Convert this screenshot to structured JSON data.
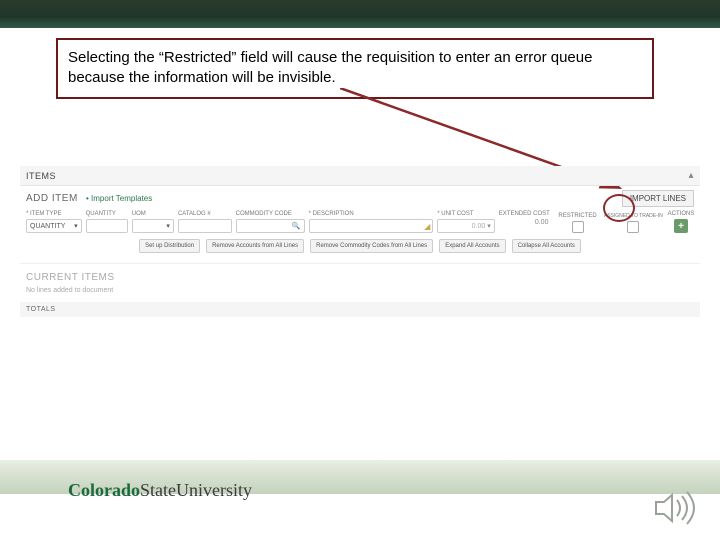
{
  "callout_text": "Selecting the “Restricted” field will cause the requisition to enter an error queue because the information will be invisible.",
  "panels": {
    "items": "ITEMS"
  },
  "add_item": {
    "title": "ADD ITEM",
    "import_templates": "• Import Templates",
    "import_lines_btn": "IMPORT LINES"
  },
  "columns": {
    "item_type": "* ITEM TYPE",
    "quantity": "QUANTITY",
    "uom": "UOM",
    "catalog": "CATALOG #",
    "commodity": "COMMODITY CODE",
    "description": "* DESCRIPTION",
    "unit_cost": "* UNIT COST",
    "extended": "EXTENDED COST",
    "restricted": "RESTRICTED",
    "assigned": "ASSIGNED TO TRADE-IN",
    "actions": "ACTIONS"
  },
  "fields": {
    "quantity_sel": "QUANTITY",
    "unit_cost_value": "0.00",
    "extended_value": "0.00"
  },
  "buttons": {
    "setup_dist": "Set up Distribution",
    "remove_accounts": "Remove Accounts from All Lines",
    "remove_commodity": "Remove Commodity Codes from All Lines",
    "expand_all": "Expand All Accounts",
    "collapse_all": "Collapse All Accounts"
  },
  "current_items": {
    "heading": "CURRENT ITEMS",
    "empty": "No lines added to document"
  },
  "totals_label": "TOTALS",
  "logo": {
    "part1": "Colorado",
    "part2": "State",
    "part3": "University"
  }
}
